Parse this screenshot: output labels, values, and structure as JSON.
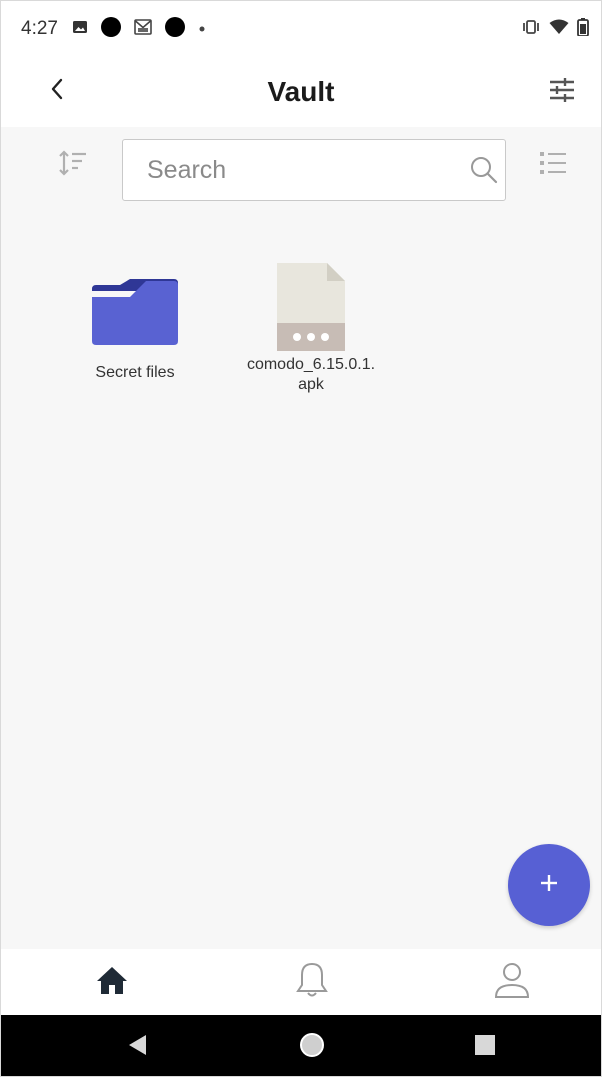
{
  "status_bar": {
    "time": "4:27",
    "left_icons": [
      "image-icon",
      "dot-icon",
      "gmail-icon",
      "dot-icon",
      "small-dot-icon"
    ],
    "right_icons": [
      "vibrate-icon",
      "wifi-icon",
      "battery-icon"
    ]
  },
  "app_bar": {
    "title": "Vault",
    "back_icon": "chevron-left-icon",
    "filter_icon": "tune-icon"
  },
  "search": {
    "placeholder": "Search",
    "value": ""
  },
  "files": [
    {
      "name": "Secret files",
      "type": "folder",
      "icon": "folder-icon"
    },
    {
      "name_line1": "comodo_6.15.0.1.",
      "name_line2": "apk",
      "type": "file",
      "icon": "file-icon"
    }
  ],
  "fab": {
    "icon": "plus-icon",
    "label": "+"
  },
  "bottom_nav": [
    "home-icon",
    "bell-icon",
    "profile-icon"
  ],
  "system_nav": [
    "back-triangle-icon",
    "home-circle-icon",
    "recents-square-icon"
  ],
  "colors": {
    "accent": "#5760d4",
    "folder": "#5962d2",
    "folder_tab": "#2f3796",
    "file_body": "#e8e6dd",
    "file_band": "#c7bcb5",
    "background": "#f7f7f7"
  }
}
